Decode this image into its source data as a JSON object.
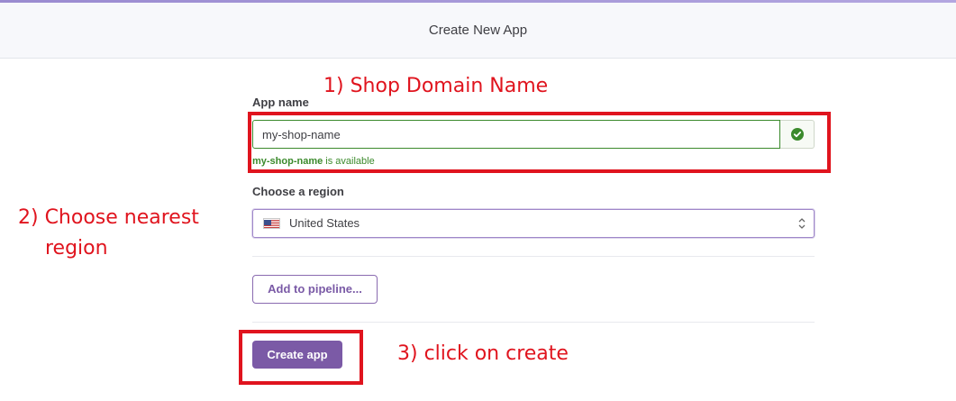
{
  "header": {
    "title": "Create New App"
  },
  "form": {
    "app_name_label": "App name",
    "app_name_value": "my-shop-name",
    "availability_name": "my-shop-name",
    "availability_suffix": " is available",
    "region_label": "Choose a region",
    "region_value": "United States",
    "region_flag_icon": "us-flag-icon",
    "pipeline_button_label": "Add to pipeline...",
    "create_button_label": "Create app"
  },
  "annotations": {
    "step1": "1) Shop Domain Name",
    "step2_line1": "2) Choose nearest",
    "step2_line2": "region",
    "step3": "3) click on create",
    "color": "#e0141e"
  },
  "colors": {
    "accent_purple": "#7b5aa6",
    "success_green": "#3b8a2c"
  }
}
